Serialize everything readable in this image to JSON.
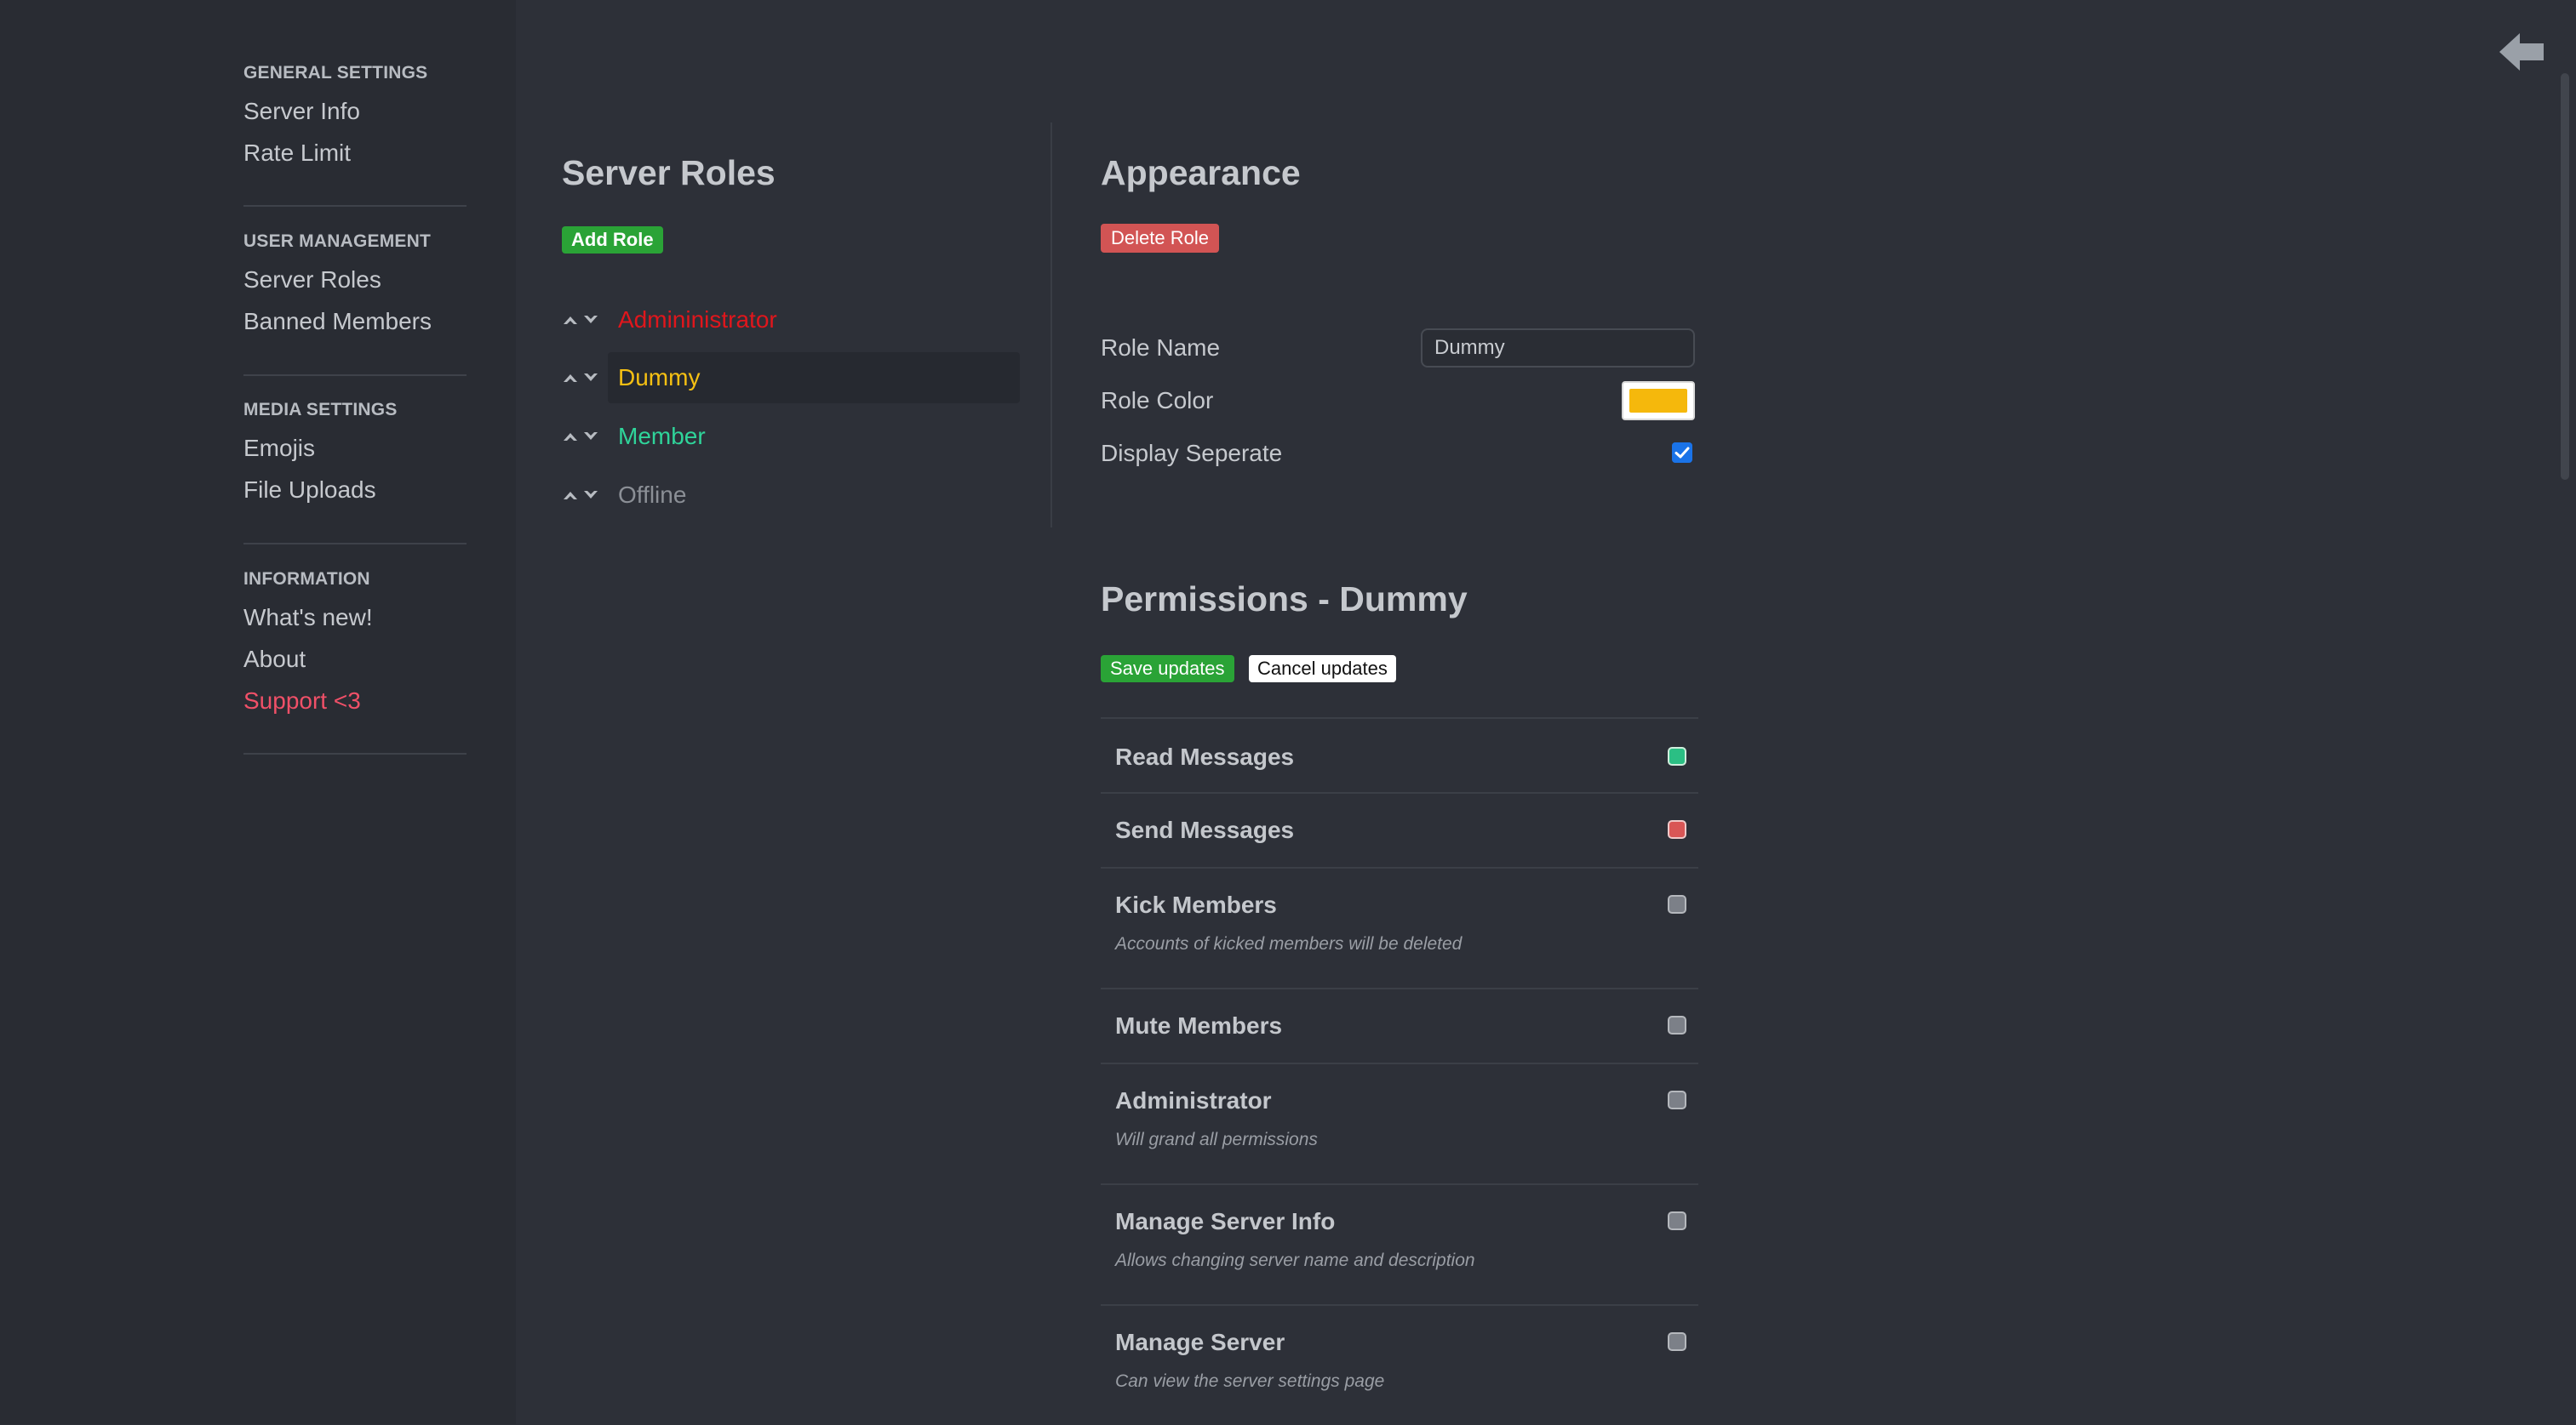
{
  "sidebar": {
    "sections": [
      {
        "header": "GENERAL SETTINGS",
        "items": [
          "Server Info",
          "Rate Limit"
        ]
      },
      {
        "header": "USER MANAGEMENT",
        "items": [
          "Server Roles",
          "Banned Members"
        ]
      },
      {
        "header": "MEDIA SETTINGS",
        "items": [
          "Emojis",
          "File Uploads"
        ]
      },
      {
        "header": "INFORMATION",
        "items": [
          "What's new!",
          "About",
          "Support <3"
        ]
      }
    ]
  },
  "roles": {
    "title": "Server Roles",
    "add_label": "Add Role",
    "items": [
      {
        "name": "Admininistrator",
        "color": "#e0161c"
      },
      {
        "name": "Dummy",
        "color": "#f5c013"
      },
      {
        "name": "Member",
        "color": "#2fd49a"
      },
      {
        "name": "Offline",
        "color": "#8b8f96"
      }
    ],
    "selected": "Dummy"
  },
  "appearance": {
    "title": "Appearance",
    "delete_label": "Delete Role",
    "role_name_label": "Role Name",
    "role_name_value": "Dummy",
    "role_color_label": "Role Color",
    "role_color_value": "#f5b80c",
    "display_separate_label": "Display Seperate",
    "display_separate_checked": true
  },
  "permissions": {
    "title": "Permissions - Dummy",
    "save_label": "Save updates",
    "cancel_label": "Cancel updates",
    "items": [
      {
        "title": "Read Messages",
        "desc": "",
        "state": "on"
      },
      {
        "title": "Send Messages",
        "desc": "",
        "state": "off"
      },
      {
        "title": "Kick Members",
        "desc": "Accounts of kicked members will be deleted",
        "state": "none"
      },
      {
        "title": "Mute Members",
        "desc": "",
        "state": "none"
      },
      {
        "title": "Administrator",
        "desc": "Will grand all permissions",
        "state": "none"
      },
      {
        "title": "Manage Server Info",
        "desc": "Allows changing server name and description",
        "state": "none"
      },
      {
        "title": "Manage Server",
        "desc": "Can view the server settings page",
        "state": "none"
      }
    ]
  },
  "colors": {
    "support": "#f05068",
    "perm_on": "#2bbf84",
    "perm_off": "#d95656",
    "perm_none": "#7c8088"
  }
}
